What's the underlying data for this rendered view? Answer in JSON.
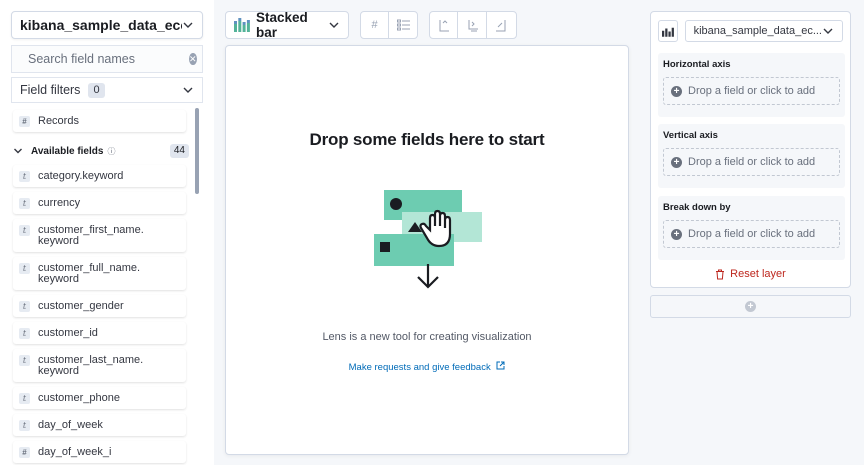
{
  "sidebar": {
    "index_pattern": "kibana_sample_data_ecom...",
    "search_placeholder": "Search field names",
    "field_filters_label": "Field filters",
    "field_filters_count": "0",
    "records_label": "Records",
    "available_fields_label": "Available fields",
    "available_fields_count": "44",
    "fields": [
      {
        "type": "t",
        "name": "category.keyword"
      },
      {
        "type": "t",
        "name": "currency"
      },
      {
        "type": "t",
        "name": "customer_first_name.\nkeyword"
      },
      {
        "type": "t",
        "name": "customer_full_name.\nkeyword"
      },
      {
        "type": "t",
        "name": "customer_gender"
      },
      {
        "type": "t",
        "name": "customer_id"
      },
      {
        "type": "t",
        "name": "customer_last_name.\nkeyword"
      },
      {
        "type": "t",
        "name": "customer_phone"
      },
      {
        "type": "t",
        "name": "day_of_week"
      },
      {
        "type": "#",
        "name": "day_of_week_i"
      }
    ]
  },
  "toolbar": {
    "chart_type": "Stacked bar"
  },
  "workspace": {
    "title": "Drop some fields here to start",
    "subtitle": "Lens is a new tool for creating visualization",
    "feedback_link": "Make requests and give feedback"
  },
  "config": {
    "layer_index": "kibana_sample_data_ec...",
    "horizontal_axis": "Horizontal axis",
    "vertical_axis": "Vertical axis",
    "break_down": "Break down by",
    "drop_placeholder": "Drop a field or click to add",
    "reset_layer": "Reset layer"
  },
  "colors": {
    "accent": "#006bb8",
    "danger": "#bd271e",
    "illustration_green": "#54b399"
  }
}
